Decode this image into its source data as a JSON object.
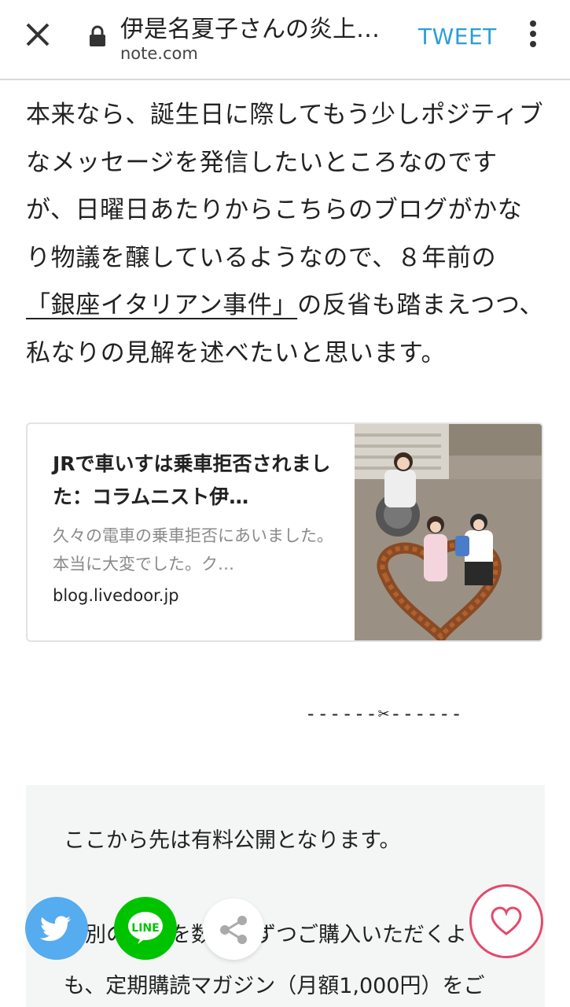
{
  "header": {
    "title": "伊是名夏子さんの炎上…",
    "domain": "note.com",
    "tweet_label": "TWEET",
    "close_icon": "close-icon",
    "lock_icon": "lock-icon",
    "menu_icon": "more-vert-icon"
  },
  "article": {
    "para_part1": "本来なら、誕生日に際してもう少しポジティブなメッセージを発信したいところなのですが、日曜日あたりからこちらのブログがかなり物議を醸しているようなので、８年前の",
    "link_text": "「銀座イタリアン事件」",
    "para_part2": "の反省も踏まえつつ、私なりの見解を述べたいと思います。",
    "separator": "------✂------"
  },
  "link_card": {
    "title": "JRで車いすは乗車拒否されました：コラムニスト伊…",
    "description": "久々の電車の乗車拒否にあいました。本当に大変でした。ク…",
    "domain": "blog.livedoor.jp"
  },
  "paid_box": {
    "line1": "ここから先は有料公開となります。",
    "line2": "個別の記事を数百円ずつご購入いただくよ",
    "line3": "も、定期購読マガジン（月額1,000円）をご"
  },
  "share_bar": {
    "twitter_icon": "twitter-icon",
    "line_label": "LINE",
    "share_icon": "share-icon",
    "like_icon": "heart-icon"
  },
  "colors": {
    "tweet": "#2a9fd6",
    "twitter": "#55acee",
    "line": "#00c300",
    "like": "#e24b6e"
  }
}
